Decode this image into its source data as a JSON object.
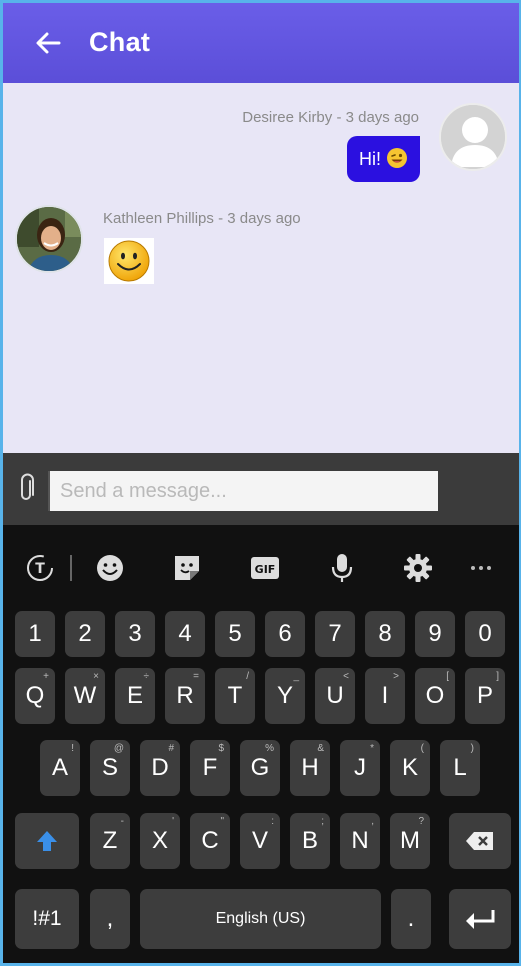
{
  "header": {
    "title": "Chat"
  },
  "messages": [
    {
      "author": "Desiree Kirby - 3 days ago",
      "text": "Hi!"
    },
    {
      "author": "Kathleen Phillips - 3 days ago",
      "sticker": "smiley-sticker"
    }
  ],
  "composer": {
    "placeholder": "Send a message..."
  },
  "keyboard": {
    "row_numbers": [
      "1",
      "2",
      "3",
      "4",
      "5",
      "6",
      "7",
      "8",
      "9",
      "0"
    ],
    "row1": [
      {
        "k": "Q",
        "h": "+"
      },
      {
        "k": "W",
        "h": "×"
      },
      {
        "k": "E",
        "h": "÷"
      },
      {
        "k": "R",
        "h": "="
      },
      {
        "k": "T",
        "h": "/"
      },
      {
        "k": "Y",
        "h": "_"
      },
      {
        "k": "U",
        "h": "<"
      },
      {
        "k": "I",
        "h": ">"
      },
      {
        "k": "O",
        "h": "["
      },
      {
        "k": "P",
        "h": "]"
      }
    ],
    "row2": [
      {
        "k": "A",
        "h": "!"
      },
      {
        "k": "S",
        "h": "@"
      },
      {
        "k": "D",
        "h": "#"
      },
      {
        "k": "F",
        "h": "$"
      },
      {
        "k": "G",
        "h": "%"
      },
      {
        "k": "H",
        "h": "&"
      },
      {
        "k": "J",
        "h": "*"
      },
      {
        "k": "K",
        "h": "("
      },
      {
        "k": "L",
        "h": ")"
      }
    ],
    "row3": [
      {
        "k": "Z",
        "h": "-"
      },
      {
        "k": "X",
        "h": "'"
      },
      {
        "k": "C",
        "h": "\""
      },
      {
        "k": "V",
        "h": ":"
      },
      {
        "k": "B",
        "h": ";"
      },
      {
        "k": "N",
        "h": ","
      },
      {
        "k": "M",
        "h": "?"
      }
    ],
    "symbols_label": "!#1",
    "comma_label": ",",
    "space_label": "English (US)",
    "period_label": "."
  },
  "colors": {
    "appbar": "#5b4ed8",
    "bubble": "#2b10e0",
    "chat_bg": "#e8e6f6",
    "shift": "#3a8fe8"
  }
}
